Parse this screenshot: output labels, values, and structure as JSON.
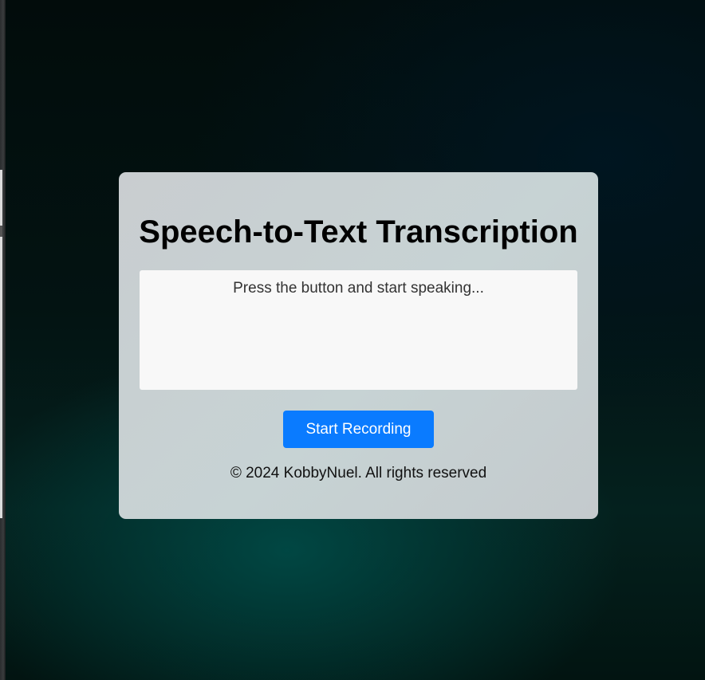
{
  "card": {
    "title": "Speech-to-Text Transcription",
    "transcript_placeholder": "Press the button and start speaking...",
    "record_button_label": "Start Recording",
    "footer_text": "© 2024 KobbyNuel. All rights reserved"
  },
  "colors": {
    "accent": "#0a7bff",
    "card_background": "#c9cfd1",
    "transcript_background": "#f8f8f8",
    "page_background": "#031312"
  }
}
